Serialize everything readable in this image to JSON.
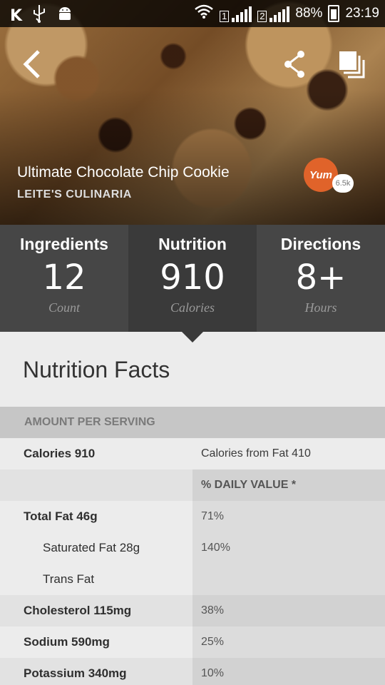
{
  "status_bar": {
    "left_icons": [
      "K",
      "usb-icon",
      "android-icon"
    ],
    "sim1": "1",
    "sim2": "2",
    "battery": "88%",
    "time": "23:19"
  },
  "hero": {
    "title": "Ultimate Chocolate Chip Cookie",
    "source": "LEITE'S CULINARIA",
    "yum_label": "Yum",
    "yum_count": "6.5k"
  },
  "tabs": [
    {
      "label": "Ingredients",
      "value": "12",
      "unit": "Count"
    },
    {
      "label": "Nutrition",
      "value": "910",
      "unit": "Calories"
    },
    {
      "label": "Directions",
      "value": "8+",
      "unit": "Hours"
    }
  ],
  "nutrition": {
    "title": "Nutrition Facts",
    "amount_header": "AMOUNT PER SERVING",
    "calories": "Calories 910",
    "calories_from_fat": "Calories from Fat 410",
    "daily_value_header": "% DAILY VALUE *",
    "rows": [
      {
        "label": "Total Fat 46g",
        "value": "71%"
      },
      {
        "label": "Saturated Fat 28g",
        "value": "140%"
      },
      {
        "label": "Trans Fat",
        "value": ""
      },
      {
        "label": "Cholesterol 115mg",
        "value": "38%"
      },
      {
        "label": "Sodium 590mg",
        "value": "25%"
      },
      {
        "label": "Potassium 340mg",
        "value": "10%"
      }
    ]
  },
  "colors": {
    "tab_bg": "#464646",
    "tab_active_bg": "#3a3a3a",
    "yum_orange": "#e0632a",
    "amount_header_bg": "#c6c6c6"
  }
}
